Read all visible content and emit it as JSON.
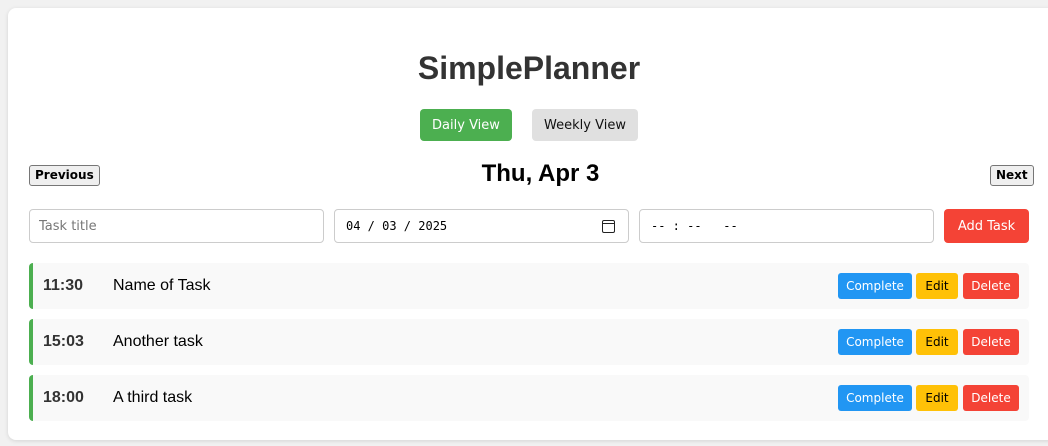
{
  "app": {
    "title": "SimplePlanner"
  },
  "views": {
    "daily_label": "Daily View",
    "weekly_label": "Weekly View"
  },
  "nav": {
    "previous_label": "Previous",
    "next_label": "Next",
    "current_date": "Thu, Apr 3"
  },
  "form": {
    "title_placeholder": "Task title",
    "title_value": "",
    "date_value": "04 / 03 / 2025",
    "time_value": "-- : --   --",
    "add_label": "Add Task"
  },
  "tasks": [
    {
      "time": "11:30",
      "title": "Name of Task",
      "complete_label": "Complete",
      "edit_label": "Edit",
      "delete_label": "Delete"
    },
    {
      "time": "15:03",
      "title": "Another task",
      "complete_label": "Complete",
      "edit_label": "Edit",
      "delete_label": "Delete"
    },
    {
      "time": "18:00",
      "title": "A third task",
      "complete_label": "Complete",
      "edit_label": "Edit",
      "delete_label": "Delete"
    }
  ],
  "colors": {
    "accent_green": "#4caf50",
    "complete_blue": "#2196f3",
    "edit_amber": "#ffc107",
    "delete_red": "#f44336"
  },
  "icons": {
    "date_picker": "calendar-icon"
  }
}
